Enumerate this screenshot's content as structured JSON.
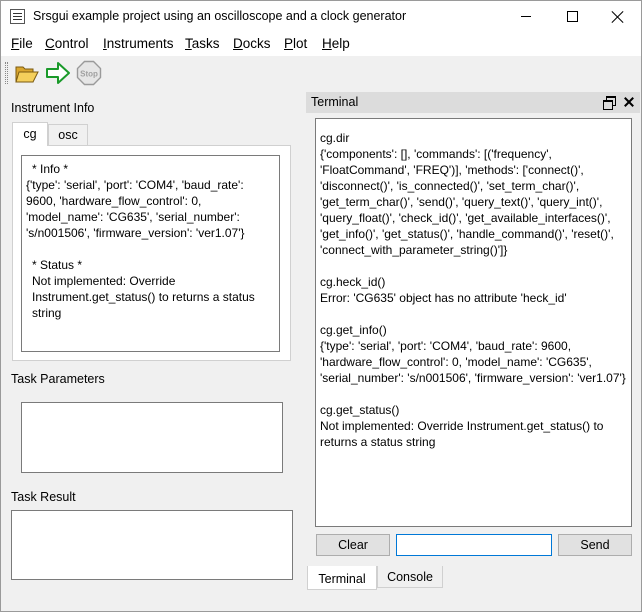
{
  "window": {
    "title": "Srsgui example project using an oscilloscope and a clock generator"
  },
  "menu": {
    "items": [
      "File",
      "Control",
      "Instruments",
      "Tasks",
      "Docks",
      "Plot",
      "Help"
    ]
  },
  "toolbar": {
    "tools": [
      {
        "icon": "folder-open-icon"
      },
      {
        "icon": "run-arrow-icon"
      },
      {
        "icon": "stop-icon",
        "label": "Stop"
      }
    ]
  },
  "instrument_info": {
    "label": "Instrument Info",
    "tabs": [
      "cg",
      "osc"
    ],
    "selected_tab": "cg",
    "lines": [
      " * Info *",
      "{'type': 'serial', 'port': 'COM4', 'baud_rate': 9600, 'hardware_flow_control': 0, 'model_name': 'CG635', 'serial_number': 's/n001506', 'firmware_version': 'ver1.07'}",
      "",
      " * Status *",
      "Not implemented: Override Instrument.get_status() to returns a status string"
    ]
  },
  "task_parameters": {
    "label": "Task Parameters"
  },
  "task_result": {
    "label": "Task Result"
  },
  "terminal": {
    "title": "Terminal",
    "entries": [
      "cg.dir",
      "{'components': [], 'commands': [('frequency', 'FloatCommand', 'FREQ')], 'methods': ['connect()', 'disconnect()', 'is_connected()', 'set_term_char()', 'get_term_char()', 'send()', 'query_text()', 'query_int()', 'query_float()', 'check_id()', 'get_available_interfaces()', 'get_info()', 'get_status()', 'handle_command()', 'reset()', 'connect_with_parameter_string()']}",
      "cg.heck_id()",
      "Error: 'CG635' object has no attribute 'heck_id'",
      "cg.get_info()",
      "{'type': 'serial', 'port': 'COM4', 'baud_rate': 9600, 'hardware_flow_control': 0, 'model_name': 'CG635', 'serial_number': 's/n001506', 'firmware_version': 'ver1.07'}",
      "cg.get_status()",
      "Not implemented: Override Instrument.get_status() to returns a status string"
    ],
    "clear_label": "Clear",
    "send_label": "Send",
    "input_value": "",
    "bottom_tabs": [
      "Terminal",
      "Console"
    ],
    "selected_bottom_tab": "Terminal"
  },
  "colors": {
    "input_focus": "#0078d7",
    "dock_title_bg": "#dcdcdc",
    "window_bg": "#f0f0f0"
  }
}
